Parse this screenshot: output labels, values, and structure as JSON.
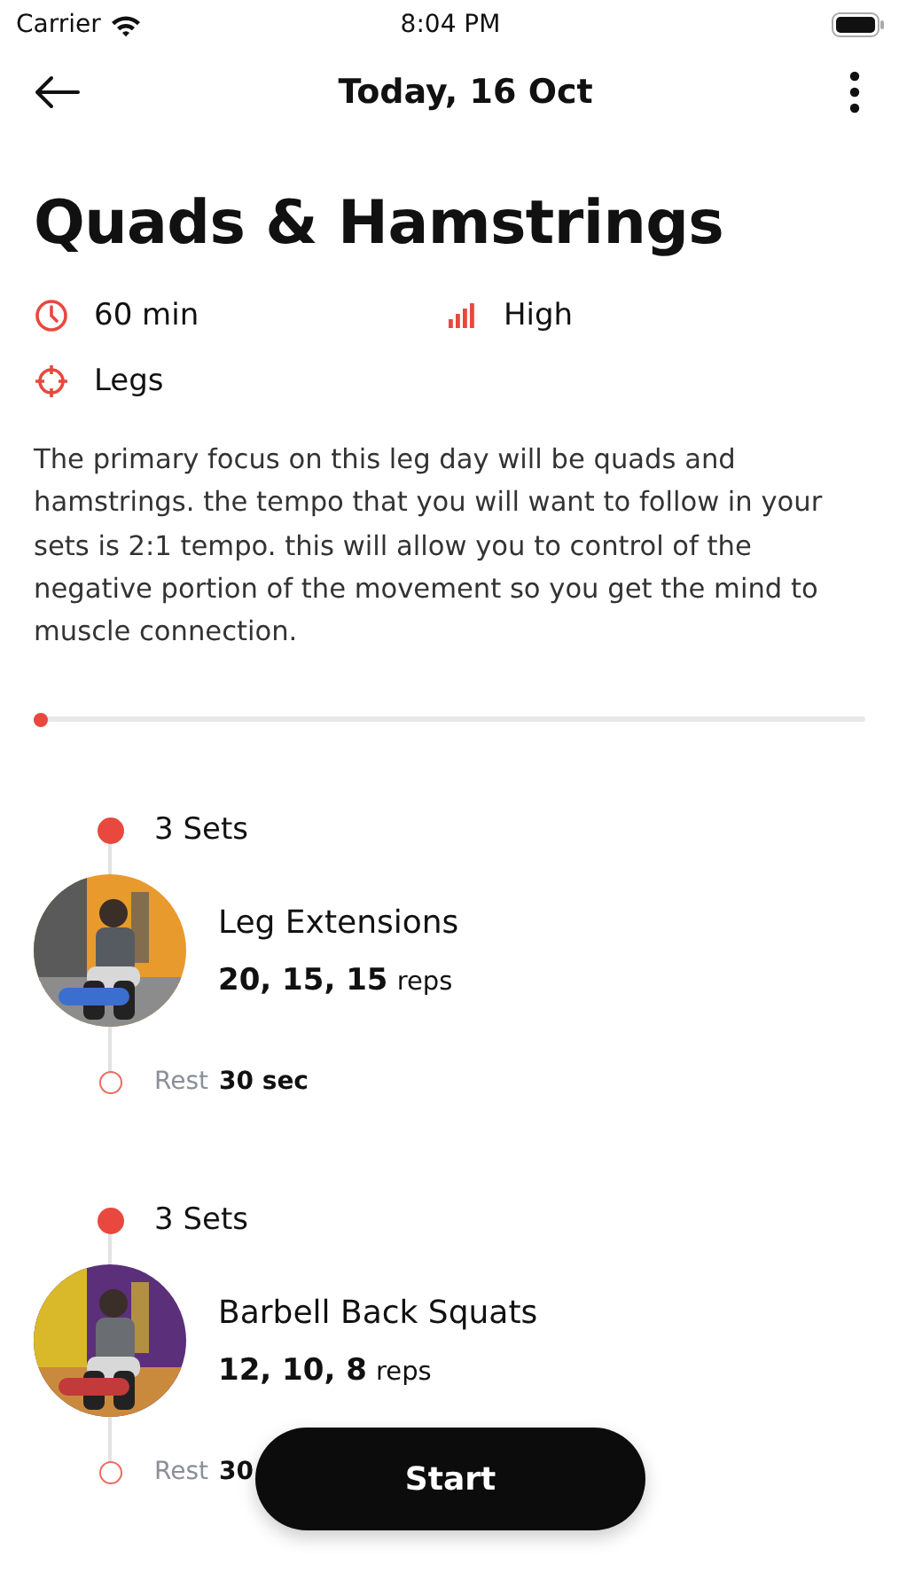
{
  "status_bar": {
    "carrier": "Carrier",
    "time": "8:04 PM"
  },
  "header": {
    "title": "Today, 16 Oct"
  },
  "workout": {
    "title": "Quads & Hamstrings",
    "duration": "60 min",
    "intensity": "High",
    "target": "Legs",
    "description": "The primary focus on this leg day will be quads and hamstrings. the tempo that you will want to follow in your sets is 2:1 tempo. this will allow you to control of the negative portion of the movement so you get the mind to muscle connection.",
    "progress": {
      "level": 0
    }
  },
  "exercises": [
    {
      "sets": "3 Sets",
      "name": "Leg Extensions",
      "reps": "20, 15, 15",
      "reps_unit": "reps",
      "rest_label": "Rest",
      "rest": "30 sec"
    },
    {
      "sets": "3 Sets",
      "name": "Barbell Back Squats",
      "reps": "12, 10, 8",
      "reps_unit": "reps",
      "rest_label": "Rest",
      "rest": "30"
    }
  ],
  "start_button": {
    "label": "Start"
  }
}
